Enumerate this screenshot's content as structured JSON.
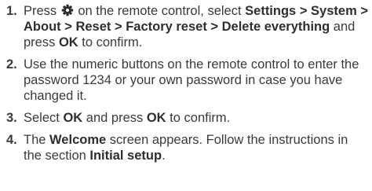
{
  "steps": [
    {
      "number": "1.",
      "parts": [
        {
          "text": "Press ",
          "bold": false
        },
        {
          "icon": "gear-icon"
        },
        {
          "text": " on the remote control, select ",
          "bold": false
        },
        {
          "text": "Settings > System > About > Reset > Factory reset > Delete everything",
          "bold": true
        },
        {
          "text": " and press ",
          "bold": false
        },
        {
          "text": "OK",
          "bold": true
        },
        {
          "text": " to confirm.",
          "bold": false
        }
      ]
    },
    {
      "number": "2.",
      "parts": [
        {
          "text": "Use the numeric buttons on the remote control to enter the password 1234 or your own password in case you have changed it.",
          "bold": false
        }
      ]
    },
    {
      "number": "3.",
      "parts": [
        {
          "text": "Select ",
          "bold": false
        },
        {
          "text": "OK",
          "bold": true
        },
        {
          "text": " and press ",
          "bold": false
        },
        {
          "text": "OK",
          "bold": true
        },
        {
          "text": " to confirm.",
          "bold": false
        }
      ]
    },
    {
      "number": "4.",
      "parts": [
        {
          "text": "The ",
          "bold": false
        },
        {
          "text": "Welcome",
          "bold": true
        },
        {
          "text": " screen appears. Follow the instructions in the section ",
          "bold": false
        },
        {
          "text": "Initial setup",
          "bold": true
        },
        {
          "text": ".",
          "bold": false
        }
      ]
    }
  ]
}
